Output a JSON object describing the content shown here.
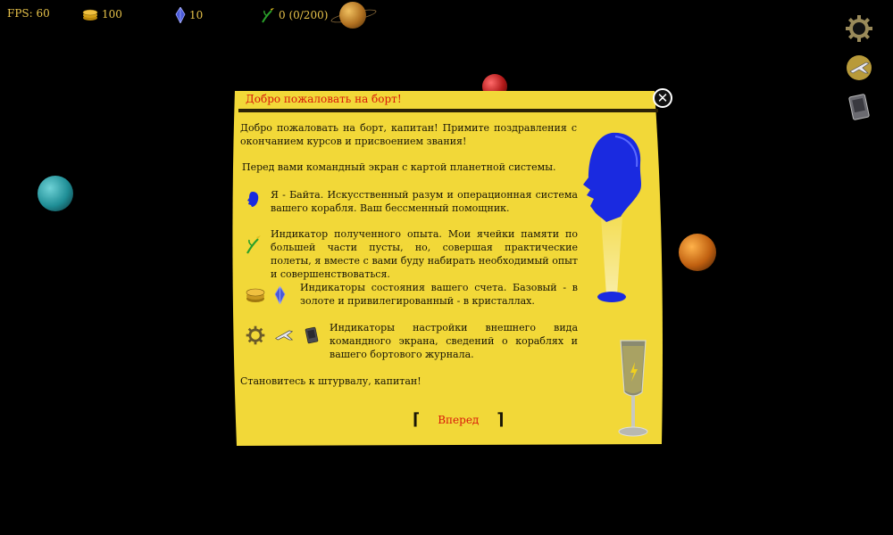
{
  "hud": {
    "fps": "FPS: 60",
    "gold": "100",
    "crystals": "10",
    "experience": "0 (0/200)"
  },
  "toolbar": {
    "settings_icon": "gear-icon",
    "ships_icon": "ship-icon",
    "journal_icon": "logbook-icon"
  },
  "dialog": {
    "title": "Добро пожаловать на борт!",
    "intro": "Добро пожаловать на борт, капитан! Примите поздравления с окончанием курсов и присвоением звания!",
    "screen_note": "Перед вами командный экран с картой планетной системы.",
    "rows": [
      {
        "text": "Я - Байта. Искусственный разум и операционная система вашего корабля. Ваш бессменный помощник."
      },
      {
        "text": "Индикатор полученного опыта. Мои ячейки памяти по большей части пусты, но, совершая практические полеты, я вместе с вами буду набирать необходимый опыт и совершенствоваться."
      },
      {
        "text": "Индикаторы состояния вашего счета. Базовый - в золоте и привилегированный - в кристаллах."
      },
      {
        "text": "Индикаторы настройки внешнего вида командного экрана, сведений о кораблях и вашего бортового журнала."
      }
    ],
    "outro": "Становитесь к штурвалу, капитан!",
    "next_label": "Вперед",
    "close_glyph": "✕"
  },
  "colors": {
    "panel": "#f2d838",
    "title_red": "#d8180a",
    "hud_text": "#e8c34a",
    "avatar_blue": "#1a2ae0"
  }
}
